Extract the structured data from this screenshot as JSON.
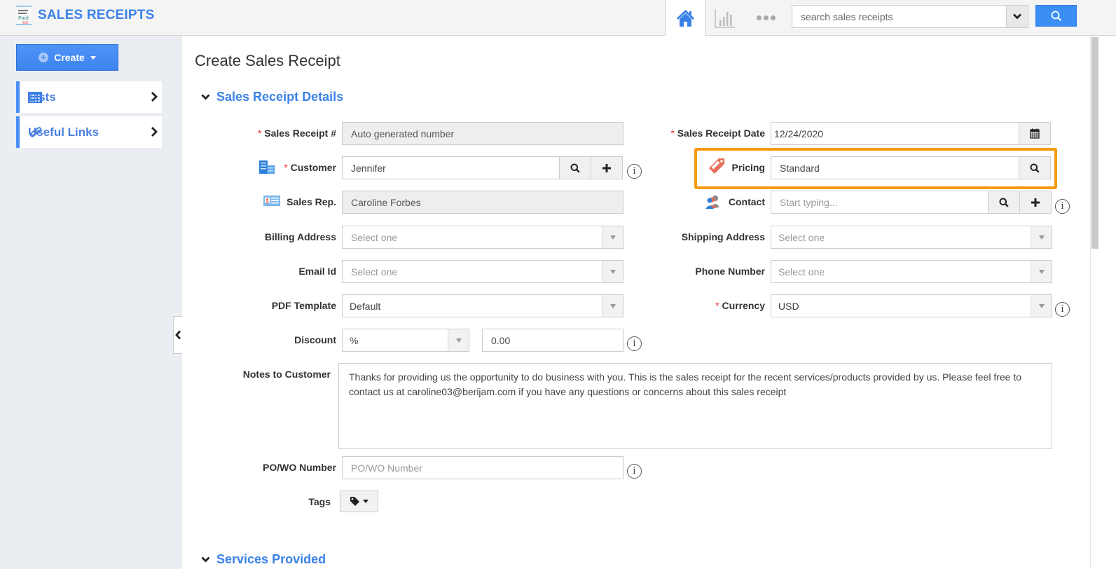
{
  "app": {
    "title": "SALES RECEIPTS",
    "logo_icon": "receipt-paid-icon",
    "logo_text": "Paid"
  },
  "topnav": {
    "home_icon": "home-icon",
    "reports_icon": "bar-chart-icon",
    "more_icon": "more-dots-icon",
    "search_placeholder": "search sales receipts",
    "search_dropdown_icon": "chevron-down-icon",
    "search_button_icon": "search-icon"
  },
  "sidebar": {
    "create_label": "Create",
    "items": [
      {
        "label": "Lists",
        "icon": "calendar-grid-icon"
      },
      {
        "label": "Useful Links",
        "icon": "link-icon"
      }
    ]
  },
  "page": {
    "title": "Create Sales Receipt",
    "section_details": "Sales Receipt Details",
    "section_services": "Services Provided"
  },
  "form": {
    "sales_receipt_no": {
      "label": "Sales Receipt #",
      "value": "Auto generated number",
      "required": true
    },
    "customer": {
      "label": "Customer",
      "value": "Jennifer",
      "required": true
    },
    "sales_rep": {
      "label": "Sales Rep.",
      "value": "Caroline Forbes"
    },
    "billing_address": {
      "label": "Billing Address",
      "placeholder": "Select one"
    },
    "email_id": {
      "label": "Email Id",
      "placeholder": "Select one"
    },
    "pdf_template": {
      "label": "PDF Template",
      "value": "Default"
    },
    "discount": {
      "label": "Discount",
      "type_value": "%",
      "amount": "0.00"
    },
    "notes": {
      "label": "Notes to Customer",
      "value": "Thanks for providing us the opportunity to do business with you. This is the sales receipt for the recent services/products provided by us. Please feel free to contact us at caroline03@berijam.com if you have any questions or concerns about this sales receipt"
    },
    "po_wo": {
      "label": "PO/WO Number",
      "placeholder": "PO/WO Number"
    },
    "tags": {
      "label": "Tags"
    },
    "sales_receipt_date": {
      "label": "Sales Receipt Date",
      "value": "12/24/2020",
      "required": true
    },
    "pricing": {
      "label": "Pricing",
      "value": "Standard"
    },
    "contact": {
      "label": "Contact",
      "placeholder": "Start typing..."
    },
    "shipping_address": {
      "label": "Shipping Address",
      "placeholder": "Select one"
    },
    "phone_number": {
      "label": "Phone Number",
      "placeholder": "Select one"
    },
    "currency": {
      "label": "Currency",
      "value": "USD",
      "required": true
    },
    "required_marker": "*",
    "info_glyph": "i"
  },
  "colors": {
    "accent": "#3b82e8",
    "highlight": "#f79a0e",
    "required": "#e33333"
  }
}
